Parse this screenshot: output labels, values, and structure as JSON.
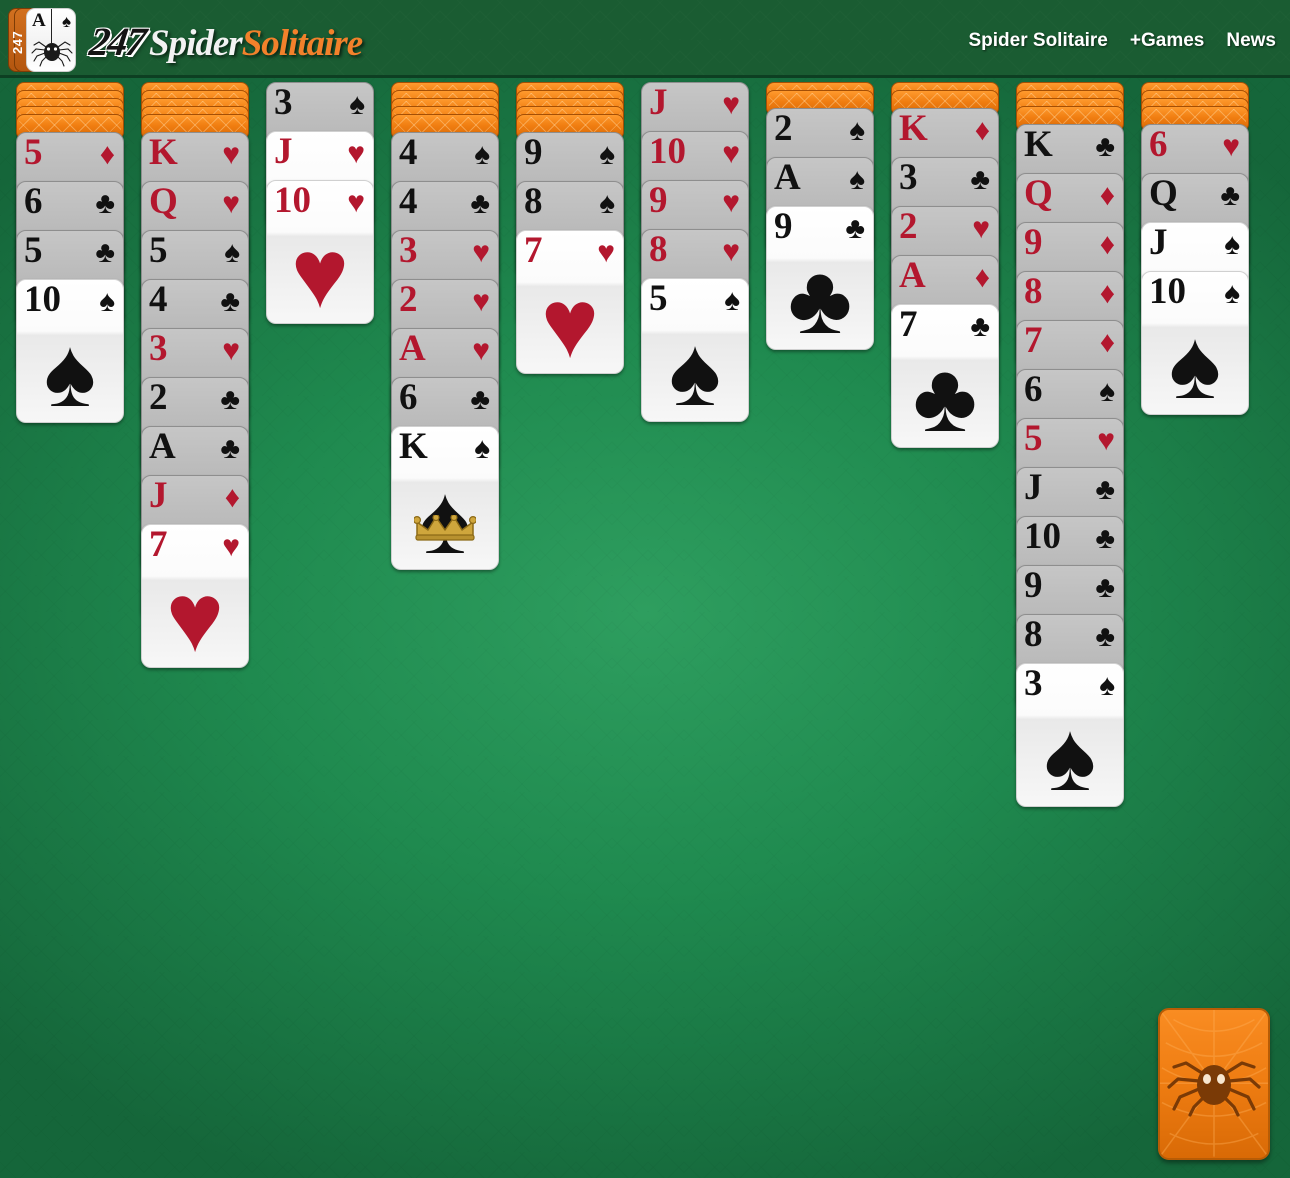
{
  "header": {
    "logo": {
      "badge_rank": "A",
      "badge_suit": "♠",
      "badge_label": "247",
      "word_247": "247",
      "word_spider": "Spider",
      "word_solitaire": "Solitaire"
    },
    "nav": [
      {
        "label": "Spider Solitaire",
        "name": "nav-spider-solitaire"
      },
      {
        "label": "+Games",
        "name": "nav-games"
      },
      {
        "label": "News",
        "name": "nav-news"
      }
    ]
  },
  "game": {
    "name": "Spider Solitaire",
    "stock_label": "Stock pile",
    "colors": {
      "felt": "#1f8a4f",
      "header": "#1a5c32",
      "card_back": "#ef7d12",
      "red_suit": "#b3172e",
      "black_suit": "#111111",
      "accent_orange": "#f2812b"
    },
    "columns": [
      {
        "index": 1,
        "facedown_count": 5,
        "cards": [
          {
            "rank": "5",
            "suit": "♦",
            "color": "red",
            "state": "dim"
          },
          {
            "rank": "6",
            "suit": "♣",
            "color": "black",
            "state": "dim"
          },
          {
            "rank": "5",
            "suit": "♣",
            "color": "black",
            "state": "dim"
          },
          {
            "rank": "10",
            "suit": "♠",
            "color": "black",
            "state": "bright"
          }
        ]
      },
      {
        "index": 2,
        "facedown_count": 5,
        "cards": [
          {
            "rank": "K",
            "suit": "♥",
            "color": "red",
            "state": "dim"
          },
          {
            "rank": "Q",
            "suit": "♥",
            "color": "red",
            "state": "dim"
          },
          {
            "rank": "5",
            "suit": "♠",
            "color": "black",
            "state": "dim"
          },
          {
            "rank": "4",
            "suit": "♣",
            "color": "black",
            "state": "dim"
          },
          {
            "rank": "3",
            "suit": "♥",
            "color": "red",
            "state": "dim"
          },
          {
            "rank": "2",
            "suit": "♣",
            "color": "black",
            "state": "dim"
          },
          {
            "rank": "A",
            "suit": "♣",
            "color": "black",
            "state": "dim"
          },
          {
            "rank": "J",
            "suit": "♦",
            "color": "red",
            "state": "dim"
          },
          {
            "rank": "7",
            "suit": "♥",
            "color": "red",
            "state": "bright"
          }
        ]
      },
      {
        "index": 3,
        "facedown_count": 0,
        "cards": [
          {
            "rank": "3",
            "suit": "♠",
            "color": "black",
            "state": "dim"
          },
          {
            "rank": "J",
            "suit": "♥",
            "color": "red",
            "state": "bright"
          },
          {
            "rank": "10",
            "suit": "♥",
            "color": "red",
            "state": "bright"
          }
        ]
      },
      {
        "index": 4,
        "facedown_count": 5,
        "cards": [
          {
            "rank": "4",
            "suit": "♠",
            "color": "black",
            "state": "dim"
          },
          {
            "rank": "4",
            "suit": "♣",
            "color": "black",
            "state": "dim"
          },
          {
            "rank": "3",
            "suit": "♥",
            "color": "red",
            "state": "dim"
          },
          {
            "rank": "2",
            "suit": "♥",
            "color": "red",
            "state": "dim"
          },
          {
            "rank": "A",
            "suit": "♥",
            "color": "red",
            "state": "dim"
          },
          {
            "rank": "6",
            "suit": "♣",
            "color": "black",
            "state": "dim"
          },
          {
            "rank": "K",
            "suit": "♠",
            "color": "black",
            "state": "bright",
            "crown": true
          }
        ]
      },
      {
        "index": 5,
        "facedown_count": 5,
        "cards": [
          {
            "rank": "9",
            "suit": "♠",
            "color": "black",
            "state": "dim"
          },
          {
            "rank": "8",
            "suit": "♠",
            "color": "black",
            "state": "dim"
          },
          {
            "rank": "7",
            "suit": "♥",
            "color": "red",
            "state": "bright"
          }
        ]
      },
      {
        "index": 6,
        "facedown_count": 0,
        "cards": [
          {
            "rank": "J",
            "suit": "♥",
            "color": "red",
            "state": "dim"
          },
          {
            "rank": "10",
            "suit": "♥",
            "color": "red",
            "state": "dim"
          },
          {
            "rank": "9",
            "suit": "♥",
            "color": "red",
            "state": "dim"
          },
          {
            "rank": "8",
            "suit": "♥",
            "color": "red",
            "state": "dim"
          },
          {
            "rank": "5",
            "suit": "♠",
            "color": "black",
            "state": "bright"
          }
        ]
      },
      {
        "index": 7,
        "facedown_count": 2,
        "cards": [
          {
            "rank": "2",
            "suit": "♠",
            "color": "black",
            "state": "dim"
          },
          {
            "rank": "A",
            "suit": "♠",
            "color": "black",
            "state": "dim"
          },
          {
            "rank": "9",
            "suit": "♣",
            "color": "black",
            "state": "bright"
          }
        ]
      },
      {
        "index": 8,
        "facedown_count": 2,
        "cards": [
          {
            "rank": "K",
            "suit": "♦",
            "color": "red",
            "state": "dim"
          },
          {
            "rank": "3",
            "suit": "♣",
            "color": "black",
            "state": "dim"
          },
          {
            "rank": "2",
            "suit": "♥",
            "color": "red",
            "state": "dim"
          },
          {
            "rank": "A",
            "suit": "♦",
            "color": "red",
            "state": "dim"
          },
          {
            "rank": "7",
            "suit": "♣",
            "color": "black",
            "state": "bright"
          }
        ]
      },
      {
        "index": 9,
        "facedown_count": 4,
        "cards": [
          {
            "rank": "K",
            "suit": "♣",
            "color": "black",
            "state": "dim"
          },
          {
            "rank": "Q",
            "suit": "♦",
            "color": "red",
            "state": "dim"
          },
          {
            "rank": "9",
            "suit": "♦",
            "color": "red",
            "state": "dim"
          },
          {
            "rank": "8",
            "suit": "♦",
            "color": "red",
            "state": "dim"
          },
          {
            "rank": "7",
            "suit": "♦",
            "color": "red",
            "state": "dim"
          },
          {
            "rank": "6",
            "suit": "♠",
            "color": "black",
            "state": "dim"
          },
          {
            "rank": "5",
            "suit": "♥",
            "color": "red",
            "state": "dim"
          },
          {
            "rank": "J",
            "suit": "♣",
            "color": "black",
            "state": "dim"
          },
          {
            "rank": "10",
            "suit": "♣",
            "color": "black",
            "state": "dim"
          },
          {
            "rank": "9",
            "suit": "♣",
            "color": "black",
            "state": "dim"
          },
          {
            "rank": "8",
            "suit": "♣",
            "color": "black",
            "state": "dim"
          },
          {
            "rank": "3",
            "suit": "♠",
            "color": "black",
            "state": "bright"
          }
        ]
      },
      {
        "index": 10,
        "facedown_count": 4,
        "cards": [
          {
            "rank": "6",
            "suit": "♥",
            "color": "red",
            "state": "dim"
          },
          {
            "rank": "Q",
            "suit": "♣",
            "color": "black",
            "state": "dim"
          },
          {
            "rank": "J",
            "suit": "♠",
            "color": "black",
            "state": "bright"
          },
          {
            "rank": "10",
            "suit": "♠",
            "color": "black",
            "state": "bright"
          }
        ]
      }
    ]
  }
}
